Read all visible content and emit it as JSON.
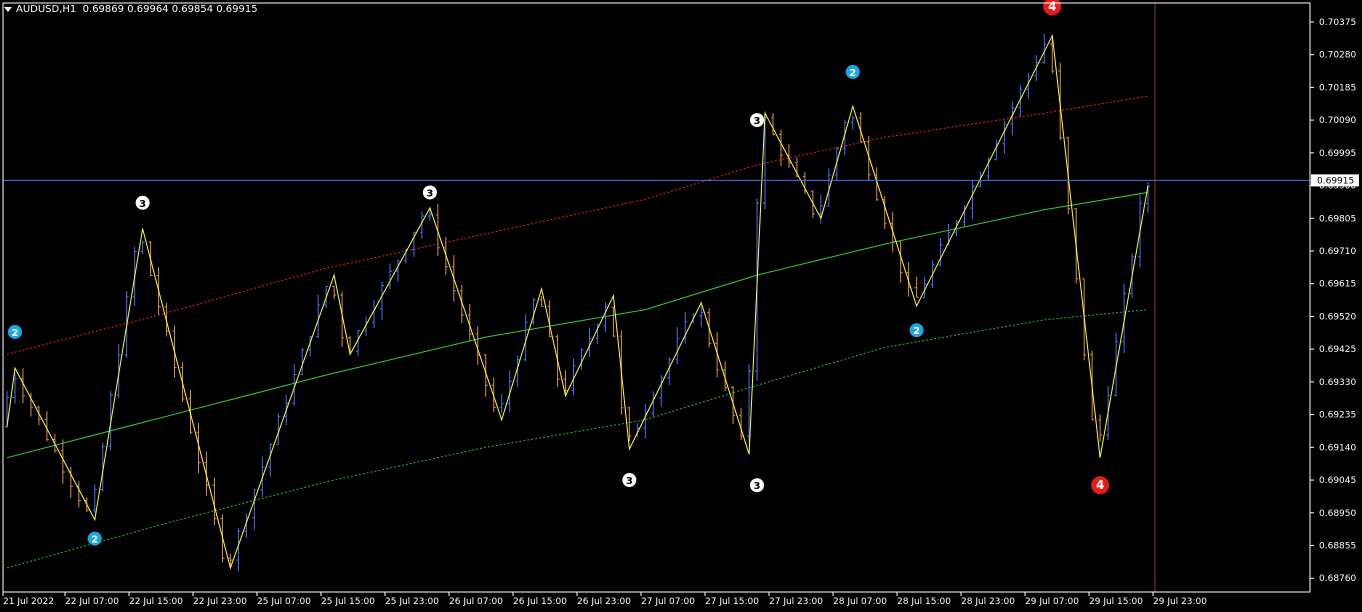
{
  "header": {
    "symbol": "AUDUSD,H1",
    "ohlc": "0.69869 0.69964 0.69854 0.69915"
  },
  "colors": {
    "background": "#000000",
    "grid_frame": "#ffffff",
    "bull": "#4a6cf7",
    "bear": "#e08a4a",
    "zigzag": "#ffff33",
    "ma_mid": "#33cc33",
    "band_upper": "#dd2222",
    "band_lower": "#22bb22",
    "price_line": "#4a6cf7",
    "marker_blue": "#19a7e8",
    "marker_white": "#ffffff",
    "marker_red": "#e81b1b"
  },
  "chart_data": {
    "type": "line",
    "symbol": "AUDUSD",
    "timeframe": "H1",
    "ylim": [
      0.6872,
      0.7043
    ],
    "y_ticks": [
      "0.70375",
      "0.70280",
      "0.70185",
      "0.70090",
      "0.69995",
      "0.69900",
      "0.69805",
      "0.69710",
      "0.69615",
      "0.69520",
      "0.69425",
      "0.69330",
      "0.69235",
      "0.69140",
      "0.69045",
      "0.68950",
      "0.68855",
      "0.68760"
    ],
    "x_ticks": [
      "21 Jul 2022",
      "22 Jul 07:00",
      "22 Jul 15:00",
      "22 Jul 23:00",
      "25 Jul 07:00",
      "25 Jul 15:00",
      "25 Jul 23:00",
      "26 Jul 07:00",
      "26 Jul 15:00",
      "26 Jul 23:00",
      "27 Jul 07:00",
      "27 Jul 15:00",
      "27 Jul 23:00",
      "28 Jul 07:00",
      "28 Jul 15:00",
      "28 Jul 23:00",
      "29 Jul 07:00",
      "29 Jul 15:00",
      "29 Jul 23:00"
    ],
    "current_price": 0.69915,
    "current_price_label": "0.69915",
    "zigzag": [
      {
        "bar": 0,
        "price": 0.692
      },
      {
        "bar": 1,
        "price": 0.6937
      },
      {
        "bar": 11,
        "price": 0.6893
      },
      {
        "bar": 17,
        "price": 0.69775
      },
      {
        "bar": 28,
        "price": 0.6879
      },
      {
        "bar": 41,
        "price": 0.6964
      },
      {
        "bar": 43,
        "price": 0.6941
      },
      {
        "bar": 53,
        "price": 0.69835
      },
      {
        "bar": 62,
        "price": 0.6922
      },
      {
        "bar": 67,
        "price": 0.696
      },
      {
        "bar": 70,
        "price": 0.6929
      },
      {
        "bar": 76,
        "price": 0.6958
      },
      {
        "bar": 78,
        "price": 0.69135
      },
      {
        "bar": 87,
        "price": 0.6956
      },
      {
        "bar": 93,
        "price": 0.6912
      },
      {
        "bar": 95,
        "price": 0.7011
      },
      {
        "bar": 102,
        "price": 0.69805
      },
      {
        "bar": 106,
        "price": 0.7013
      },
      {
        "bar": 114,
        "price": 0.6955
      },
      {
        "bar": 131,
        "price": 0.70335
      },
      {
        "bar": 137,
        "price": 0.6911
      },
      {
        "bar": 143,
        "price": 0.699
      }
    ],
    "ma_mid": [
      {
        "bar": 0,
        "price": 0.6911
      },
      {
        "bar": 20,
        "price": 0.6923
      },
      {
        "bar": 40,
        "price": 0.6935
      },
      {
        "bar": 60,
        "price": 0.6946
      },
      {
        "bar": 80,
        "price": 0.6954
      },
      {
        "bar": 94,
        "price": 0.6964
      },
      {
        "bar": 110,
        "price": 0.6973
      },
      {
        "bar": 130,
        "price": 0.6983
      },
      {
        "bar": 143,
        "price": 0.6988
      }
    ],
    "band_upper": [
      {
        "bar": 0,
        "price": 0.6941
      },
      {
        "bar": 20,
        "price": 0.6953
      },
      {
        "bar": 40,
        "price": 0.6966
      },
      {
        "bar": 60,
        "price": 0.6976
      },
      {
        "bar": 80,
        "price": 0.6986
      },
      {
        "bar": 94,
        "price": 0.6996
      },
      {
        "bar": 110,
        "price": 0.7004
      },
      {
        "bar": 130,
        "price": 0.7011
      },
      {
        "bar": 143,
        "price": 0.7016
      }
    ],
    "band_lower": [
      {
        "bar": 0,
        "price": 0.6879
      },
      {
        "bar": 20,
        "price": 0.6892
      },
      {
        "bar": 40,
        "price": 0.6904
      },
      {
        "bar": 60,
        "price": 0.6914
      },
      {
        "bar": 80,
        "price": 0.6922
      },
      {
        "bar": 94,
        "price": 0.6932
      },
      {
        "bar": 110,
        "price": 0.6943
      },
      {
        "bar": 130,
        "price": 0.6951
      },
      {
        "bar": 143,
        "price": 0.6954
      }
    ],
    "markers": [
      {
        "label": "2",
        "style": "blue",
        "bar": 1,
        "price": 0.69475
      },
      {
        "label": "2",
        "style": "blue",
        "bar": 11,
        "price": 0.68875
      },
      {
        "label": "3",
        "style": "white",
        "bar": 17,
        "price": 0.6985
      },
      {
        "label": "3",
        "style": "white",
        "bar": 53,
        "price": 0.6988
      },
      {
        "label": "3",
        "style": "white",
        "bar": 78,
        "price": 0.69045
      },
      {
        "label": "3",
        "style": "white",
        "bar": 94,
        "price": 0.6903
      },
      {
        "label": "3",
        "style": "white",
        "bar": 94,
        "price": 0.7009
      },
      {
        "label": "2",
        "style": "blue",
        "bar": 106,
        "price": 0.7023
      },
      {
        "label": "2",
        "style": "blue",
        "bar": 114,
        "price": 0.6948
      },
      {
        "label": "4",
        "style": "red",
        "bar": 131,
        "price": 0.7042
      },
      {
        "label": "4",
        "style": "red",
        "bar": 137,
        "price": 0.6903
      }
    ],
    "last_bar_separator": 144,
    "n_bars": 144
  }
}
